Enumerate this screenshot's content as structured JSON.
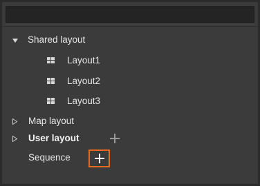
{
  "tree": {
    "shared_layout": {
      "label": "Shared layout",
      "children": [
        "Layout1",
        "Layout2",
        "Layout3"
      ]
    },
    "map_layout": {
      "label": "Map layout"
    },
    "user_layout": {
      "label": "User layout"
    },
    "sequence": {
      "label": "Sequence"
    }
  },
  "icons": {
    "expanded": "triangle-down-icon",
    "collapsed": "triangle-right-icon",
    "layout": "grid-icon",
    "add": "plus-icon"
  },
  "colors": {
    "panel": "#3b3b3b",
    "search": "#242424",
    "text": "#e6e6e6",
    "highlight": "#e86c1f"
  }
}
